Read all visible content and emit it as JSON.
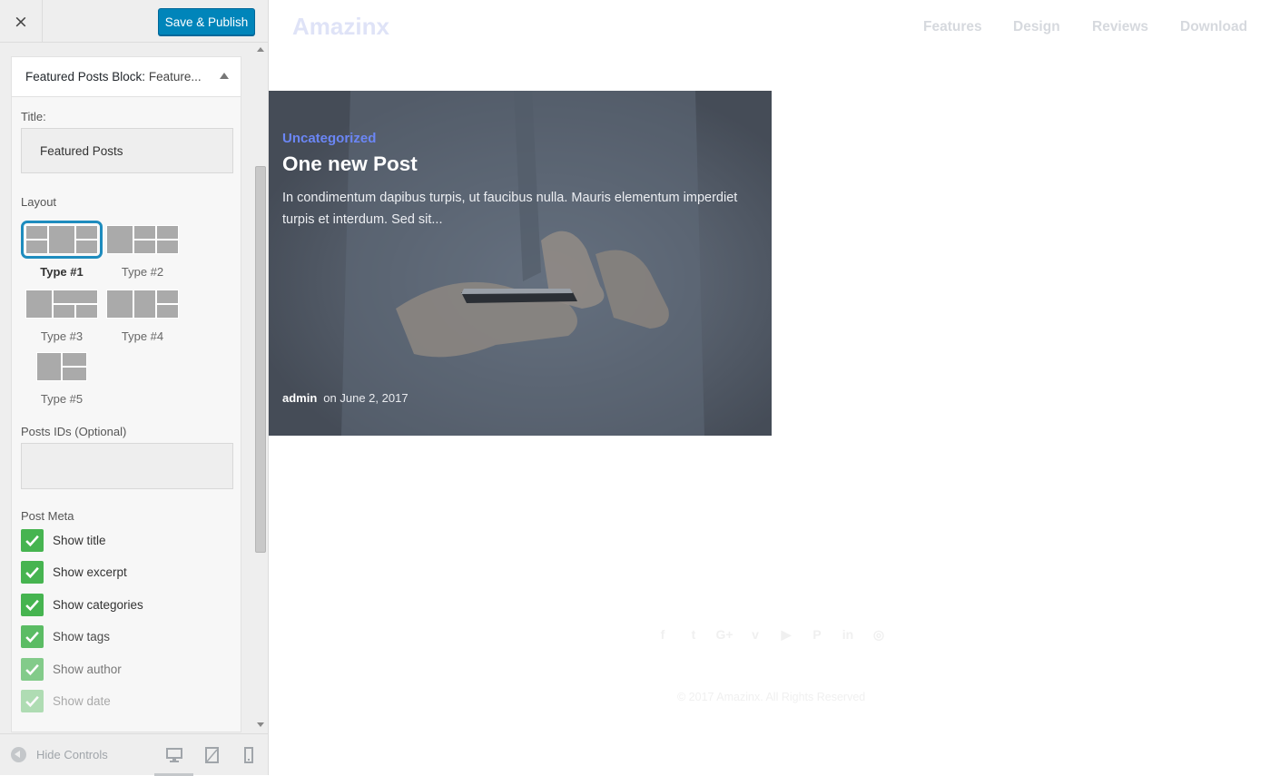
{
  "sidebar": {
    "close_label": "×",
    "save_label": "Save & Publish",
    "widget": {
      "name": "Featured Posts Block:",
      "title_inline": "Feature..."
    },
    "title_field": {
      "label": "Title:",
      "value": "Featured Posts"
    },
    "layout": {
      "label": "Layout",
      "options": [
        {
          "label": "Type #1",
          "selected": true
        },
        {
          "label": "Type #2",
          "selected": false
        },
        {
          "label": "Type #3",
          "selected": false
        },
        {
          "label": "Type #4",
          "selected": false
        },
        {
          "label": "Type #5",
          "selected": false
        }
      ]
    },
    "post_ids_field": {
      "label": "Posts IDs (Optional)",
      "value": ""
    },
    "post_meta": {
      "label": "Post Meta",
      "items": [
        {
          "label": "Show title",
          "checked": true
        },
        {
          "label": "Show excerpt",
          "checked": true
        },
        {
          "label": "Show categories",
          "checked": true
        },
        {
          "label": "Show tags",
          "checked": true
        },
        {
          "label": "Show author",
          "checked": true
        },
        {
          "label": "Show date",
          "checked": true
        }
      ]
    },
    "footer": {
      "hide_controls": "Hide Controls"
    },
    "colors": {
      "primary_button": "#0085ba",
      "checkbox": "#46b450",
      "selected_outline": "#1e8cbe"
    }
  },
  "preview": {
    "logo": "Amazinx",
    "nav": [
      "Features",
      "Design",
      "Reviews",
      "Download"
    ],
    "post": {
      "category": "Uncategorized",
      "title": "One new Post",
      "excerpt": "In condimentum dapibus turpis, ut faucibus nulla. Mauris elementum imperdiet turpis et interdum. Sed sit...",
      "author": "admin",
      "date": "on June 2, 2017"
    },
    "social_icons": [
      "facebook-icon",
      "twitter-icon",
      "google-plus-icon",
      "vimeo-icon",
      "youtube-icon",
      "pinterest-icon",
      "linkedin-icon",
      "dribbble-icon"
    ],
    "copyright": "© 2017 Amazinx. All Rights Reserved",
    "colors": {
      "category": "#6b86f5",
      "logo": "#dfe3f7"
    }
  }
}
